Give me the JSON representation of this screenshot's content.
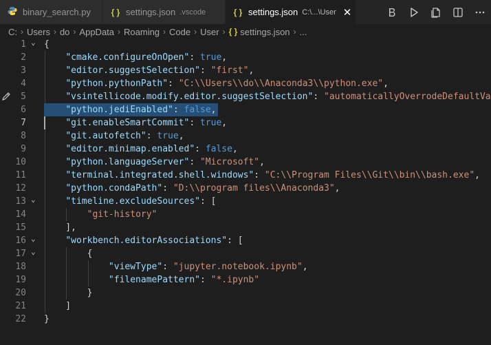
{
  "tabs": [
    {
      "label": "binary_search.py",
      "icon": "python-file-icon",
      "description": ""
    },
    {
      "label": "settings.json",
      "icon": "json-file-icon",
      "description": ".vscode"
    },
    {
      "label": "settings.json",
      "icon": "json-file-icon",
      "description": "C:\\...\\User",
      "close": "✕"
    }
  ],
  "breadcrumb": [
    "C:",
    "Users",
    "do",
    "AppData",
    "Roaming",
    "Code",
    "User",
    "settings.json",
    "..."
  ],
  "json_icon": "{ }",
  "editor": {
    "current_line": 7,
    "selected_line": 6,
    "lines": [
      [
        [
          "p",
          "{"
        ]
      ],
      [
        [
          "p",
          "    "
        ],
        [
          "k",
          "\"cmake.configureOnOpen\""
        ],
        [
          "p",
          ": "
        ],
        [
          "b",
          "true"
        ],
        [
          "p",
          ","
        ]
      ],
      [
        [
          "p",
          "    "
        ],
        [
          "k",
          "\"editor.suggestSelection\""
        ],
        [
          "p",
          ": "
        ],
        [
          "s",
          "\"first\""
        ],
        [
          "p",
          ","
        ]
      ],
      [
        [
          "p",
          "    "
        ],
        [
          "k",
          "\"python.pythonPath\""
        ],
        [
          "p",
          ": "
        ],
        [
          "s",
          "\"C:\\\\Users\\\\do\\\\Anaconda3\\\\python.exe\""
        ],
        [
          "p",
          ","
        ]
      ],
      [
        [
          "p",
          "    "
        ],
        [
          "k",
          "\"vsintellicode.modify.editor.suggestSelection\""
        ],
        [
          "p",
          ": "
        ],
        [
          "s",
          "\"automaticallyOverrodeDefaultValue\""
        ]
      ],
      [
        [
          "p",
          "    "
        ],
        [
          "k",
          "\"python.jediEnabled\""
        ],
        [
          "p",
          ": "
        ],
        [
          "b",
          "false"
        ],
        [
          "p",
          ","
        ]
      ],
      [
        [
          "p",
          "    "
        ],
        [
          "k",
          "\"git.enableSmartCommit\""
        ],
        [
          "p",
          ": "
        ],
        [
          "b",
          "true"
        ],
        [
          "p",
          ","
        ]
      ],
      [
        [
          "p",
          "    "
        ],
        [
          "k",
          "\"git.autofetch\""
        ],
        [
          "p",
          ": "
        ],
        [
          "b",
          "true"
        ],
        [
          "p",
          ","
        ]
      ],
      [
        [
          "p",
          "    "
        ],
        [
          "k",
          "\"editor.minimap.enabled\""
        ],
        [
          "p",
          ": "
        ],
        [
          "b",
          "false"
        ],
        [
          "p",
          ","
        ]
      ],
      [
        [
          "p",
          "    "
        ],
        [
          "k",
          "\"python.languageServer\""
        ],
        [
          "p",
          ": "
        ],
        [
          "s",
          "\"Microsoft\""
        ],
        [
          "p",
          ","
        ]
      ],
      [
        [
          "p",
          "    "
        ],
        [
          "k",
          "\"terminal.integrated.shell.windows\""
        ],
        [
          "p",
          ": "
        ],
        [
          "s",
          "\"C:\\\\Program Files\\\\Git\\\\bin\\\\bash.exe\""
        ],
        [
          "p",
          ","
        ]
      ],
      [
        [
          "p",
          "    "
        ],
        [
          "k",
          "\"python.condaPath\""
        ],
        [
          "p",
          ": "
        ],
        [
          "s",
          "\"D:\\\\program files\\\\Anaconda3\""
        ],
        [
          "p",
          ","
        ]
      ],
      [
        [
          "p",
          "    "
        ],
        [
          "k",
          "\"timeline.excludeSources\""
        ],
        [
          "p",
          ": ["
        ]
      ],
      [
        [
          "p",
          "        "
        ],
        [
          "s",
          "\"git-history\""
        ]
      ],
      [
        [
          "p",
          "    ],"
        ]
      ],
      [
        [
          "p",
          "    "
        ],
        [
          "k",
          "\"workbench.editorAssociations\""
        ],
        [
          "p",
          ": ["
        ]
      ],
      [
        [
          "p",
          "        {"
        ]
      ],
      [
        [
          "p",
          "            "
        ],
        [
          "k",
          "\"viewType\""
        ],
        [
          "p",
          ": "
        ],
        [
          "s",
          "\"jupyter.notebook.ipynb\""
        ],
        [
          "p",
          ","
        ]
      ],
      [
        [
          "p",
          "            "
        ],
        [
          "k",
          "\"filenamePattern\""
        ],
        [
          "p",
          ": "
        ],
        [
          "s",
          "\"*.ipynb\""
        ]
      ],
      [
        [
          "p",
          "        }"
        ]
      ],
      [
        [
          "p",
          "    ]"
        ]
      ],
      [
        [
          "p",
          "}"
        ]
      ]
    ],
    "fold_lines": [
      1,
      13,
      16,
      17
    ]
  },
  "colors": {
    "background": "#1e1e1e",
    "key": "#9cdcfe",
    "string": "#ce9178",
    "keyword": "#569cd6",
    "json_icon": "#cbcb41",
    "python_icon": "#4b8bbe"
  }
}
